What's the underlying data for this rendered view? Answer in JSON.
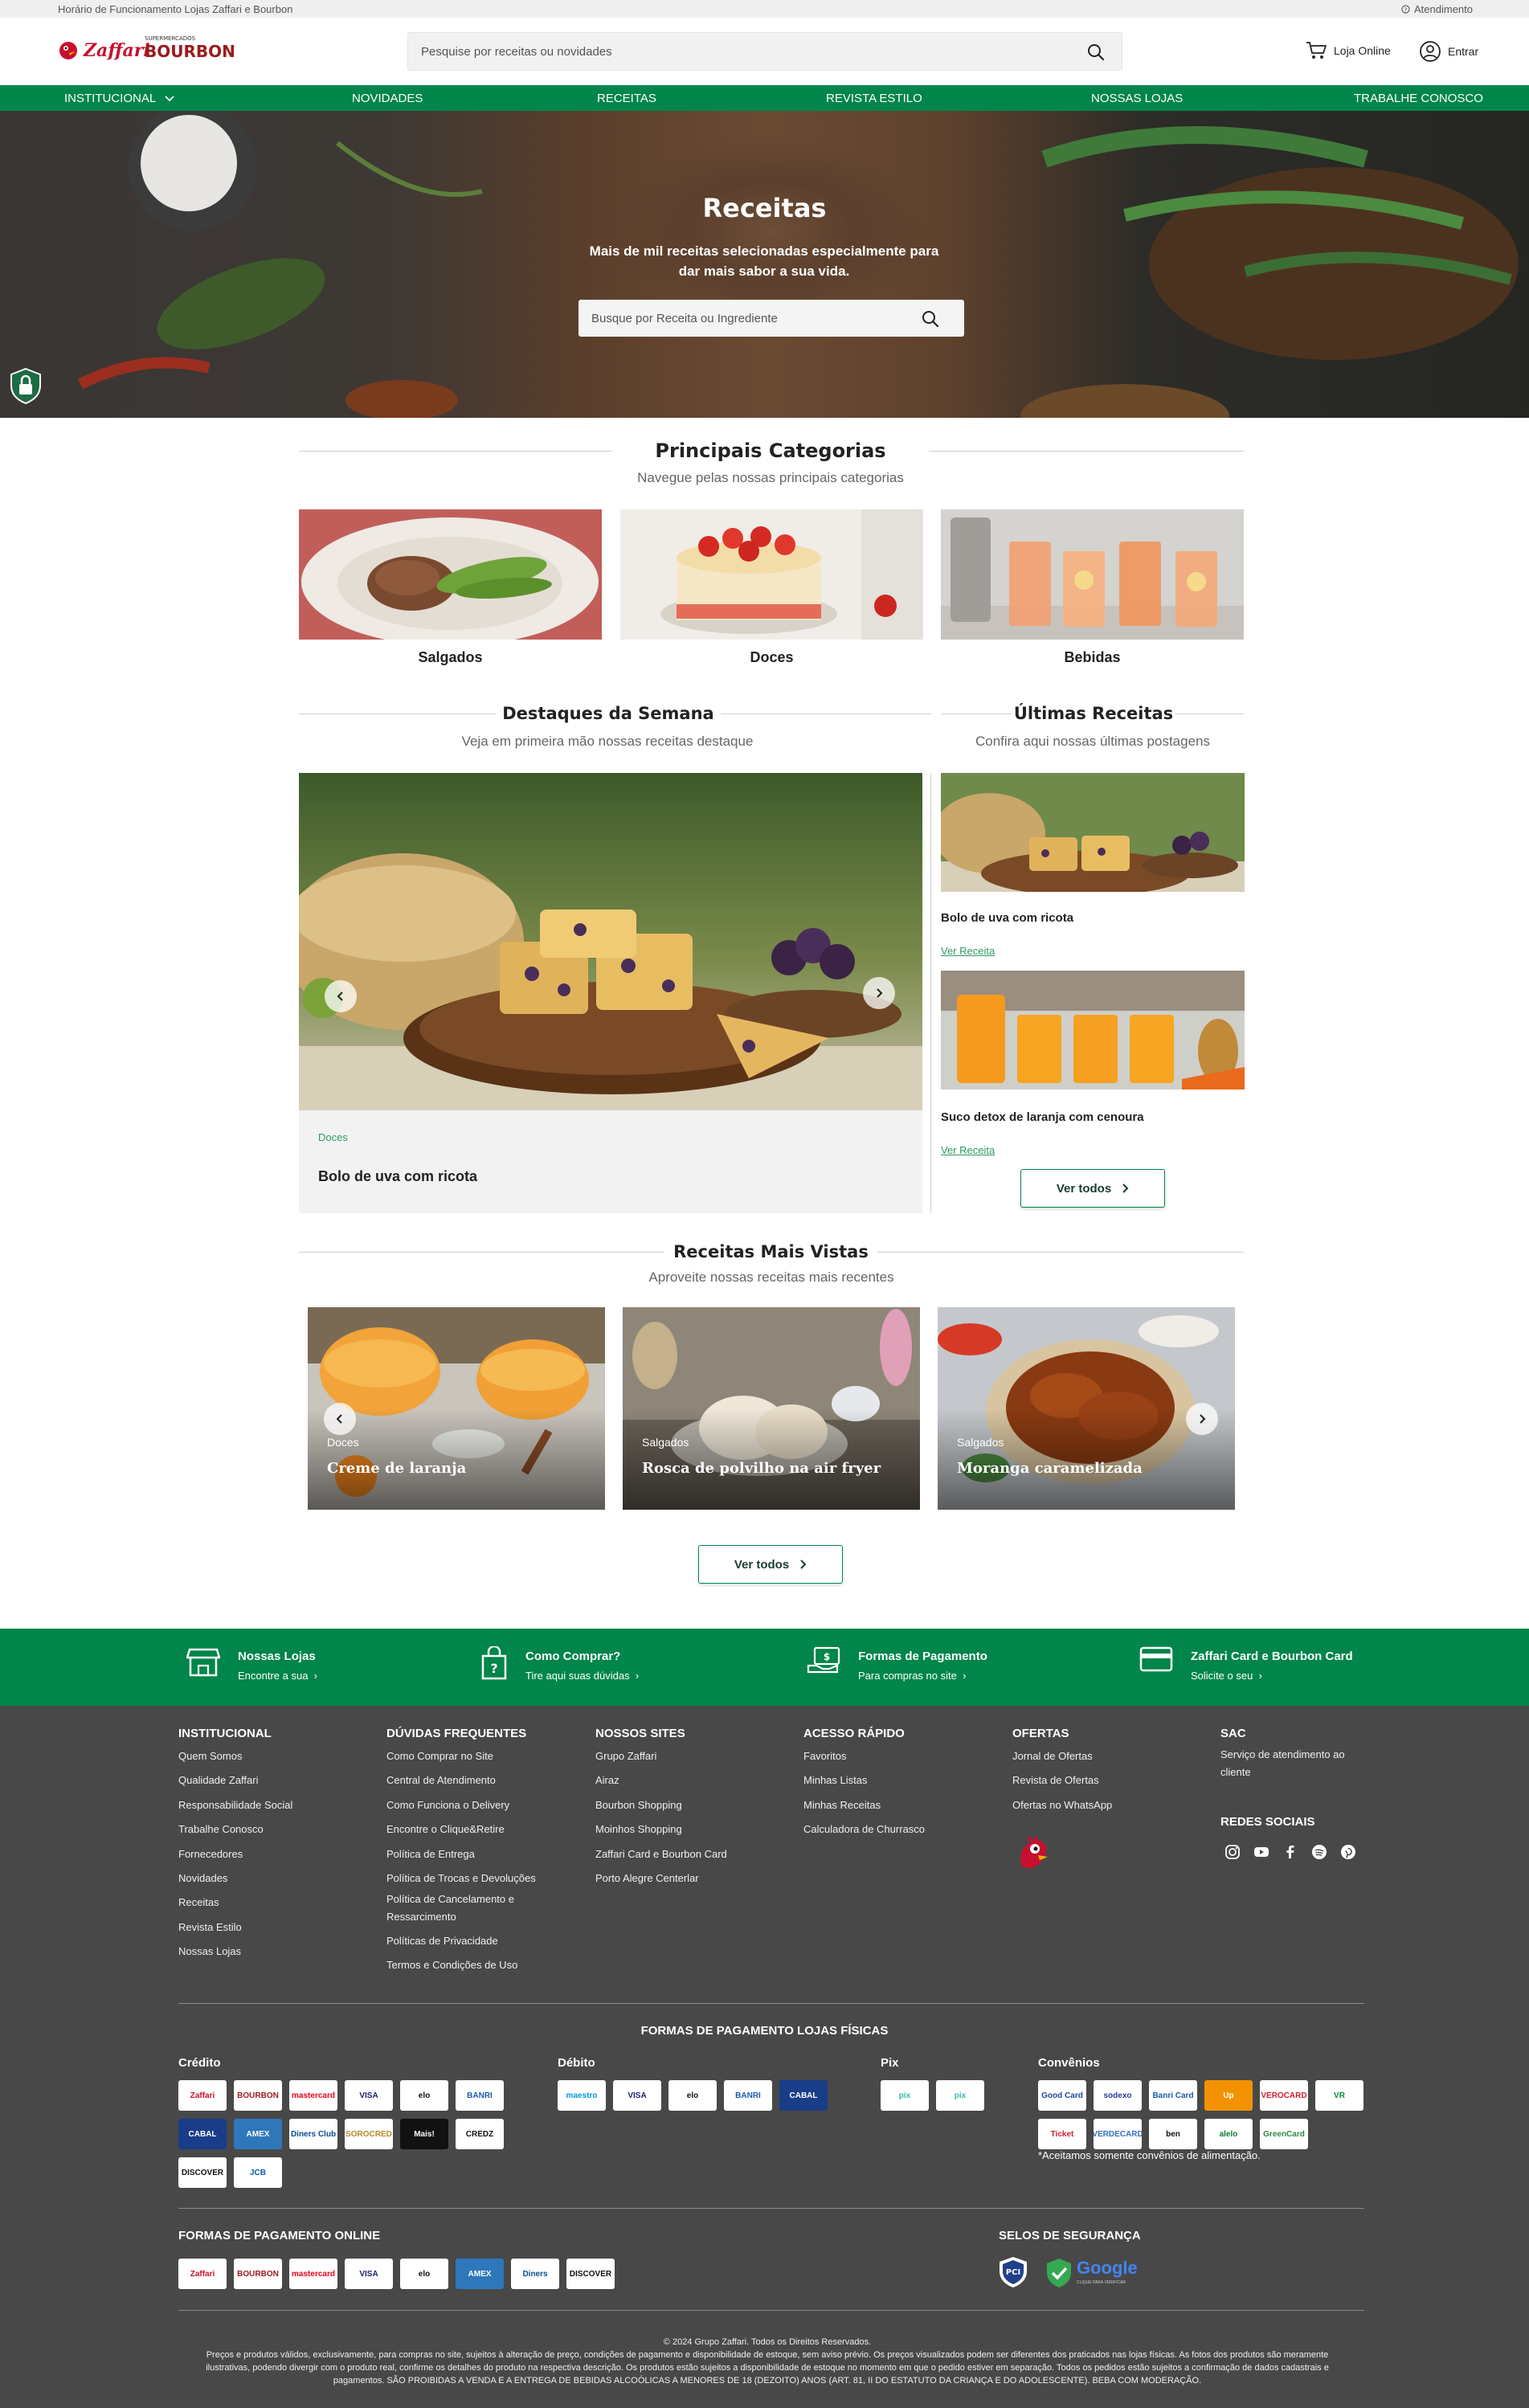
{
  "topbar": {
    "hours": "Horário de Funcionamento Lojas Zaffari e Bourbon",
    "support": "Atendimento"
  },
  "header": {
    "logo_zaffari": "Zaffari",
    "logo_bourbon": "BOURBON",
    "logo_bourbon_small": "SUPERMERCADOS",
    "search_placeholder": "Pesquise por receitas ou novidades",
    "online_store": "Loja Online",
    "login": "Entrar"
  },
  "nav": [
    "INSTITUCIONAL",
    "NOVIDADES",
    "RECEITAS",
    "REVISTA ESTILO",
    "NOSSAS LOJAS",
    "TRABALHE CONOSCO"
  ],
  "hero": {
    "title": "Receitas",
    "subtitle": "Mais de mil receitas selecionadas especialmente para dar mais sabor a sua vida.",
    "search_placeholder": "Busque por Receita ou Ingrediente"
  },
  "categories": {
    "title": "Principais Categorias",
    "subtitle": "Navegue pelas nossas principais categorias",
    "items": [
      "Salgados",
      "Doces",
      "Bebidas"
    ]
  },
  "highlights": {
    "title": "Destaques da Semana",
    "subtitle": "Veja em primeira mão nossas receitas destaque",
    "item": {
      "category": "Doces",
      "title": "Bolo de uva com ricota"
    }
  },
  "latest": {
    "title": "Últimas Receitas",
    "subtitle": "Confira aqui nossas últimas postagens",
    "items": [
      {
        "title": "Bolo de uva com ricota",
        "link": "Ver Receita"
      },
      {
        "title": "Suco detox de laranja com cenoura",
        "link": "Ver Receita"
      }
    ],
    "see_all": "Ver todos"
  },
  "most_viewed": {
    "title": "Receitas Mais Vistas",
    "subtitle": "Aproveite nossas receitas mais recentes",
    "items": [
      {
        "category": "Doces",
        "title": "Creme de laranja"
      },
      {
        "category": "Salgados",
        "title": "Rosca de polvilho na air fryer"
      },
      {
        "category": "Salgados",
        "title": "Moranga caramelizada"
      }
    ],
    "see_all": "Ver todos"
  },
  "band": [
    {
      "title": "Nossas Lojas",
      "sub": "Encontre a sua"
    },
    {
      "title": "Como Comprar?",
      "sub": "Tire aqui suas dúvidas"
    },
    {
      "title": "Formas de Pagamento",
      "sub": "Para compras no site"
    },
    {
      "title": "Zaffari Card e Bourbon Card",
      "sub": "Solicite o seu"
    }
  ],
  "footer": {
    "cols": [
      {
        "title": "INSTITUCIONAL",
        "items": [
          "Quem Somos",
          "Qualidade Zaffari",
          "Responsabilidade Social",
          "Trabalhe Conosco",
          "Fornecedores",
          "Novidades",
          "Receitas",
          "Revista Estilo",
          "Nossas Lojas"
        ]
      },
      {
        "title": "DÚVIDAS FREQUENTES",
        "items": [
          "Como Comprar no Site",
          "Central de Atendimento",
          "Como Funciona o Delivery",
          "Encontre o Clique&Retire",
          "Política de Entrega",
          "Política de Trocas e Devoluções",
          "Política de Cancelamento e Ressarcimento",
          "Políticas de Privacidade",
          "Termos e Condições de Uso"
        ]
      },
      {
        "title": "NOSSOS SITES",
        "items": [
          "Grupo Zaffari",
          "Airaz",
          "Bourbon Shopping",
          "Moinhos Shopping",
          "Zaffari Card e Bourbon Card",
          "Porto Alegre Centerlar"
        ]
      },
      {
        "title": "ACESSO RÁPIDO",
        "items": [
          "Favoritos",
          "Minhas Listas",
          "Minhas Receitas",
          "Calculadora de Churrasco"
        ]
      },
      {
        "title": "OFERTAS",
        "items": [
          "Jornal de Ofertas",
          "Revista de Ofertas",
          "Ofertas no WhatsApp"
        ]
      },
      {
        "title": "SAC",
        "items": [
          "Serviço de atendimento ao cliente"
        ]
      }
    ],
    "social_title": "REDES SOCIAIS",
    "pay_physical_title": "FORMAS DE PAGAMENTO LOJAS FÍSICAS",
    "credit": "Crédito",
    "debit": "Débito",
    "pix": "Pix",
    "vouchers": "Convênios",
    "vouchers_note": "*Aceitamos somente convênios de alimentação.",
    "credit_cards": [
      "Zaffari",
      "BOURBON",
      "mastercard",
      "VISA",
      "elo",
      "BANRI",
      "CABAL",
      "AMEX",
      "Diners Club",
      "SOROCRED",
      "Mais!",
      "CREDZ",
      "DISCOVER",
      "JCB"
    ],
    "debit_cards": [
      "maestro",
      "VISA",
      "elo",
      "BANRI",
      "CABAL"
    ],
    "pix_cards": [
      "pix",
      "pix"
    ],
    "voucher_cards": [
      "Good Card",
      "sodexo",
      "Banri Card",
      "Up",
      "VEROCARD",
      "VR",
      "Ticket",
      "VERDECARD",
      "ben",
      "alelo",
      "GreenCard"
    ],
    "pay_online_title": "FORMAS DE PAGAMENTO ONLINE",
    "online_cards": [
      "Zaffari",
      "BOURBON",
      "mastercard",
      "VISA",
      "elo",
      "AMEX",
      "Diners",
      "DISCOVER"
    ],
    "security_title": "SELOS DE SEGURANÇA",
    "security_google": "Google",
    "security_google_sub": "CLIQUE PARA VERIFICAR",
    "copyright": "© 2024 Grupo Zaffari. Todos os Direitos Reservados.",
    "legal": "Preços e produtos válidos, exclusivamente, para compras no site, sujeitos à alteração de preço, condições de pagamento e disponibilidade de estoque, sem aviso prévio. Os preços visualizados podem ser diferentes dos praticados nas lojas físicas. As fotos dos produtos são meramente ilustrativas, podendo divergir com o produto real, confirme os detalhes do produto na respectiva descrição. Os produtos estão sujeitos a disponibilidade de estoque no momento em que o pedido estiver em separação. Todos os pedidos estão sujeitos a confirmação de dados cadastrais e pagamentos. SÃO PROIBIDAS A VENDA E A ENTREGA DE BEBIDAS ALCOÓLICAS A MENORES DE 18 (DEZOITO) ANOS (ART. 81, II DO ESTATUTO DA CRIANÇA E DO ADOLESCENTE). BEBA COM MODERAÇÃO."
  },
  "colors": {
    "brand_green": "#00854a",
    "brand_red": "#c8102e",
    "footer_bg": "#484848",
    "link_green": "#2f9a5e"
  }
}
